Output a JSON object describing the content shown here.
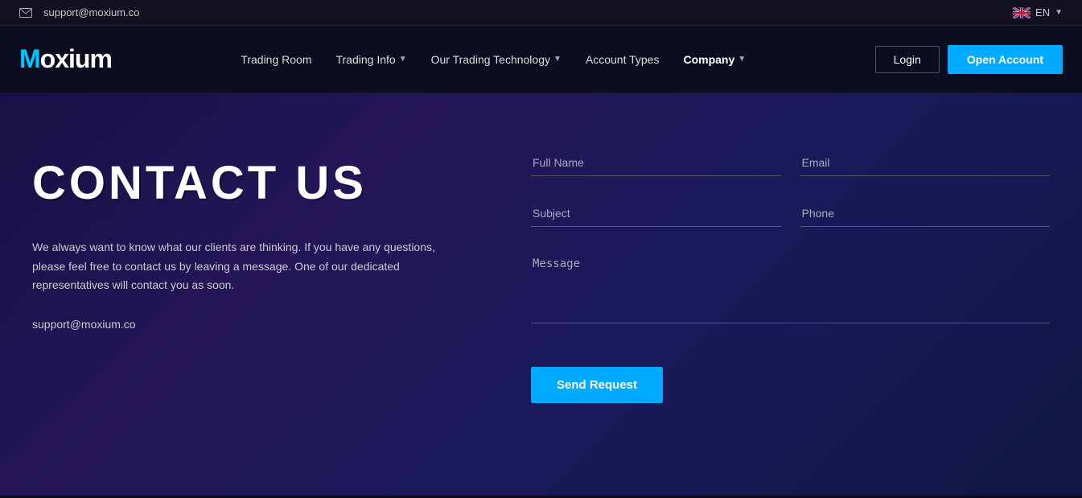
{
  "topbar": {
    "email": "support@moxium.co",
    "language": "EN"
  },
  "navbar": {
    "logo_m": "M",
    "logo_rest": "oxium",
    "links": [
      {
        "label": "Trading Room",
        "hasDropdown": false,
        "active": false
      },
      {
        "label": "Trading Info",
        "hasDropdown": true,
        "active": false
      },
      {
        "label": "Our Trading Technology",
        "hasDropdown": true,
        "active": false
      },
      {
        "label": "Account Types",
        "hasDropdown": false,
        "active": false
      },
      {
        "label": "Company",
        "hasDropdown": true,
        "active": true
      }
    ],
    "login_label": "Login",
    "open_account_label": "Open Account"
  },
  "contact": {
    "title": "CONTACT US",
    "description": "We always want to know what our clients are thinking. If you have any questions, please feel free to contact us by leaving a message. One of our dedicated representatives will contact you as soon.",
    "email": "support@moxium.co",
    "form": {
      "full_name_placeholder": "Full Name",
      "email_placeholder": "Email",
      "subject_placeholder": "Subject",
      "phone_placeholder": "Phone",
      "message_placeholder": "Message",
      "send_label": "Send Request"
    }
  }
}
